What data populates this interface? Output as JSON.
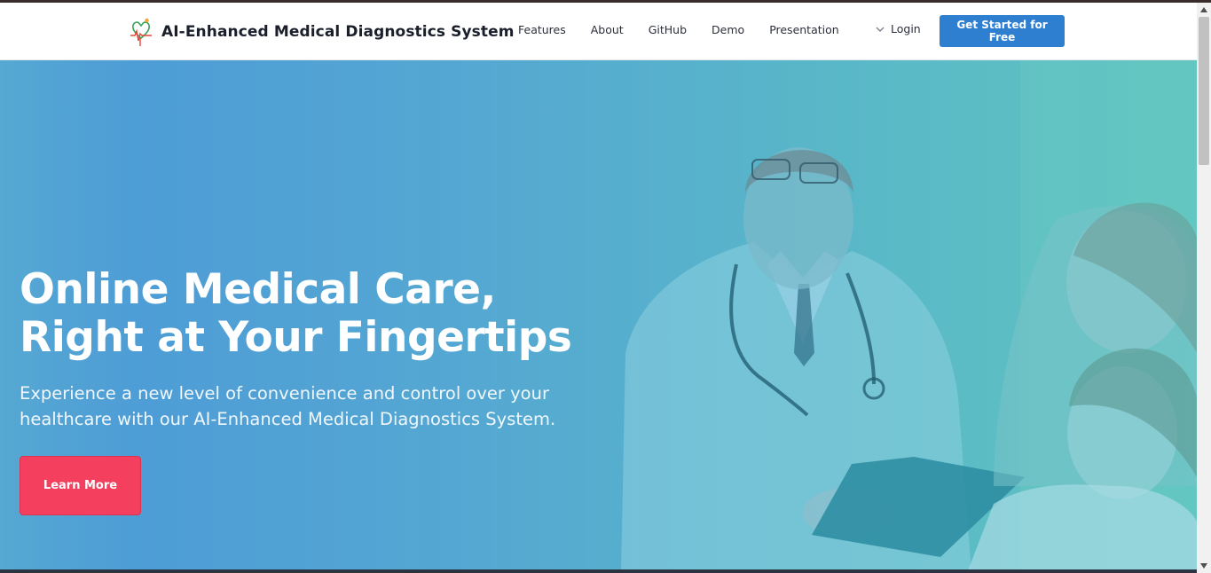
{
  "brand": {
    "title": "AI-Enhanced Medical Diagnostics System",
    "logo_icon": "heart-heartbeat-logo-icon"
  },
  "nav": {
    "items": [
      {
        "label": "Features"
      },
      {
        "label": "About"
      },
      {
        "label": "GitHub"
      },
      {
        "label": "Demo"
      },
      {
        "label": "Presentation"
      }
    ],
    "login_label": "Login",
    "login_icon": "chevron-down-icon",
    "cta_label": "Get Started for Free"
  },
  "hero": {
    "heading_line1": "Online Medical Care,",
    "heading_line2": "Right at Your Fingertips",
    "subtitle_line1": "Experience a new level of convenience and control over your",
    "subtitle_line2": "healthcare with our AI-Enhanced Medical Diagnostics System.",
    "button_label": "Learn More",
    "image_subject": "doctor-with-mother-and-daughter-photo"
  },
  "colors": {
    "accent": "#2f7fd0",
    "hero_gradient_start": "#4b98d8",
    "hero_gradient_end": "#5fc5c0",
    "button_red": "#f43f5e",
    "text_dark": "#1a1f2b"
  }
}
